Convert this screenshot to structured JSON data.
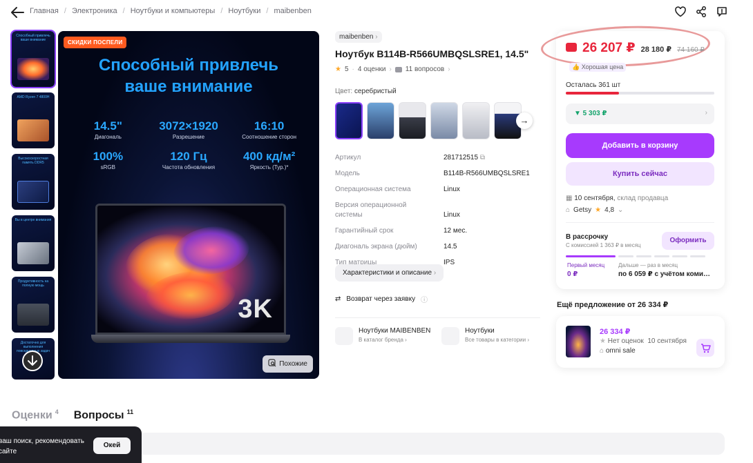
{
  "breadcrumb": [
    "Главная",
    "Электроника",
    "Ноутбуки и компьютеры",
    "Ноутбуки",
    "maibenben"
  ],
  "hero": {
    "promo": "СКИДКИ ПОСПЕЛИ",
    "title_line1": "Способный привлечь",
    "title_line2": "ваше внимание",
    "specs": [
      {
        "value": "14.5\"",
        "label": "Диагональ"
      },
      {
        "value": "3072×1920",
        "label": "Разрешение"
      },
      {
        "value": "16:10",
        "label": "Соотношение сторон"
      },
      {
        "value": "100%",
        "label": "sRGB"
      },
      {
        "value": "120 Гц",
        "label": "Частота обновления"
      },
      {
        "value": "400 кд/м²",
        "label": "Яркость (Тур.)*"
      }
    ],
    "badge_3k": "3K",
    "similar_label": "Похожие"
  },
  "thumbs": [
    {
      "caption": "Способный привлечь ваше внимание",
      "accent": "#ff8a3d"
    },
    {
      "caption": "AMD Ryzen 7 4800H",
      "accent": "#d9894a"
    },
    {
      "caption": "Высокоскоростная память DDR5",
      "accent": "#3b6fd4"
    },
    {
      "caption": "Вы в центре внимания",
      "accent": "#6f7a8a"
    },
    {
      "caption": "Продуктивность на полную мощь",
      "accent": "#5a6270"
    },
    {
      "caption": "Достаточно для выполнения повседневных задач",
      "accent": "#222631"
    }
  ],
  "product": {
    "brand": "maibenben",
    "title": "Ноутбук B114B-R566UMBQSLSRE1, 14.5\"",
    "rating": "5",
    "reviews": "4 оценки",
    "questions": "11 вопросов",
    "color_label": "Цвет:",
    "color_value": "серебристый",
    "attributes": [
      {
        "k": "Артикул",
        "v": "281712515"
      },
      {
        "k": "Модель",
        "v": "B114B-R566UMBQSLSRE1"
      },
      {
        "k": "Операционная система",
        "v": "Linux"
      },
      {
        "k": "Версия операционной системы",
        "v": "Linux"
      },
      {
        "k": "Гарантийный срок",
        "v": "12 мес."
      },
      {
        "k": "Диагональ экрана (дюйм)",
        "v": "14.5"
      },
      {
        "k": "Тип матрицы",
        "v": "IPS"
      }
    ],
    "desc_button": "Характеристики и описание",
    "return_text": "Возврат через заявку",
    "catalog_brand_title": "Ноутбуки MAIBENBEN",
    "catalog_brand_sub": "В каталог бренда",
    "catalog_cat_title": "Ноутбуки",
    "catalog_cat_sub": "Все товары в категории"
  },
  "price": {
    "card_price": "26 207 ₽",
    "price": "28 180 ₽",
    "old_price": "74 160 ₽",
    "good_price": "Хорошая цена",
    "stock": "Осталась 361 шт",
    "stock_fraction": 0.36,
    "cashback": "▼ 5 303 ₽",
    "add_to_cart": "Добавить в корзину",
    "buy_now": "Купить сейчас",
    "delivery_date": "10 сентября,",
    "delivery_source": "склад продавца",
    "seller": "Getsy",
    "seller_rating": "4,8"
  },
  "installment": {
    "title": "В рассрочку",
    "subtitle": "С комиссией 1 363 ₽ в месяц",
    "button": "Оформить",
    "first_label": "Первый месяц",
    "first_value": "0 ₽",
    "next_label": "Дальше — раз в месяц",
    "next_value": "по 6 059 ₽ с учётом комиссии"
  },
  "offer": {
    "heading": "Ещё предложение от 26 334 ₽",
    "price": "26 334 ₽",
    "rating": "Нет оценок",
    "date": "10 сентября",
    "seller": "omni sale"
  },
  "tabs": [
    {
      "label": "Оценки",
      "count": "4"
    },
    {
      "label": "Вопросы",
      "count": "11"
    }
  ],
  "toast": {
    "text": "ваш поиск, рекомендовать сайте",
    "button": "Окей"
  },
  "colors": {
    "accent": "#a73afd",
    "price": "#e8263c",
    "cashback": "#13a36b"
  }
}
